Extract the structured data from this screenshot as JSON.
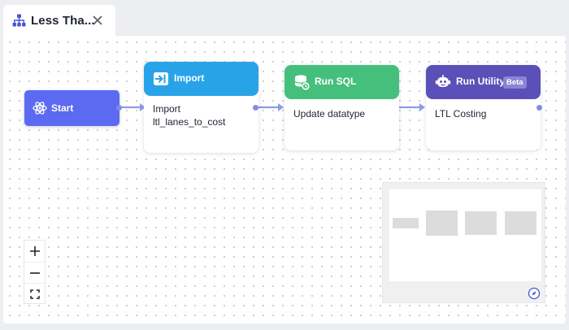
{
  "tab": {
    "title": "Less Tha...",
    "icon": "sitemap-icon",
    "close_icon": "close-icon"
  },
  "colors": {
    "start": "#5b6af0",
    "import": "#29a3e8",
    "sql": "#45c07c",
    "utility": "#5b4fb8",
    "edge": "#8f9ae8"
  },
  "nodes": {
    "start": {
      "label": "Start",
      "icon": "atom-icon"
    },
    "import": {
      "header": "Import",
      "icon": "import-icon",
      "body_line1": "Import",
      "body_line2": "ltl_lanes_to_cost"
    },
    "sql": {
      "header": "Run SQL",
      "icon": "database-icon",
      "body": "Update datatype"
    },
    "utility": {
      "header": "Run Utility",
      "badge": "Beta",
      "icon": "robot-icon",
      "body": "LTL Costing"
    }
  },
  "zoom_controls": {
    "zoom_in": "zoom-in-icon",
    "zoom_out": "zoom-out-icon",
    "fit": "fit-view-icon"
  },
  "minimap": {
    "toggle_icon": "compass-icon"
  }
}
